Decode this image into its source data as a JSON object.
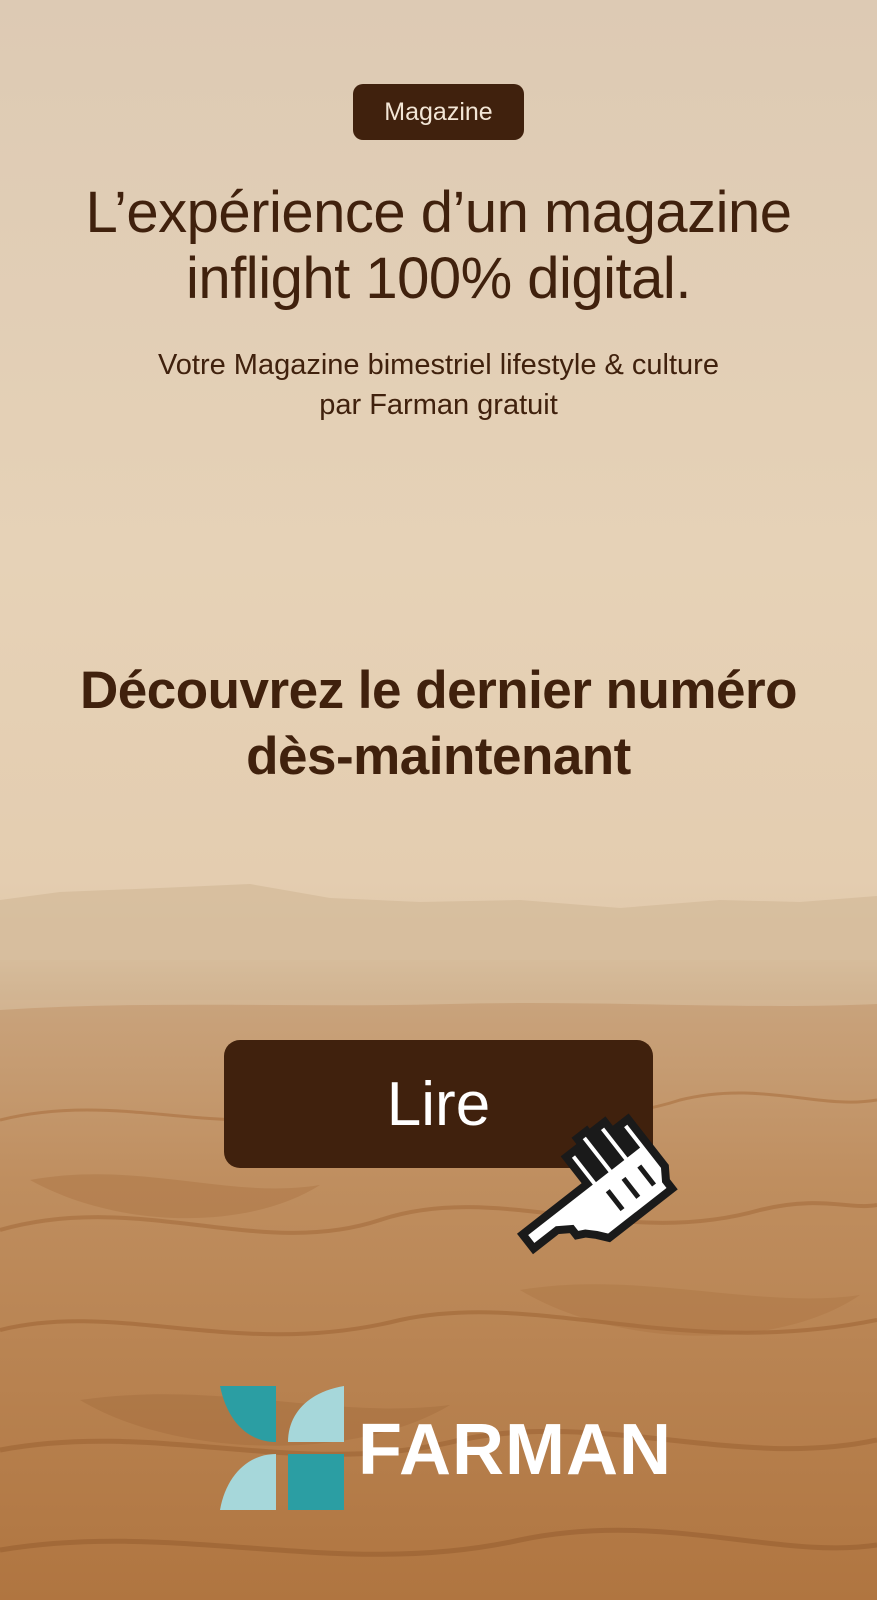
{
  "badge": {
    "label": "Magazine"
  },
  "hero": {
    "headline_line1": "L’expérience d’un magazine",
    "headline_line2": "inflight 100% digital.",
    "subtitle_line1": "Votre Magazine bimestriel lifestyle & culture",
    "subtitle_line2": "par Farman gratuit"
  },
  "cta": {
    "heading_line1": "Découvrez le dernier numéro",
    "heading_line2": "dès-maintenant",
    "button_label": "Lire"
  },
  "brand": {
    "name": "FARMAN",
    "logo": "four-petal-logo-icon"
  },
  "icons": {
    "cursor": "pointing-hand-cursor-icon"
  },
  "colors": {
    "primary_dark": "#40210d",
    "sky": "#e2cdb2",
    "sand": "#b97f4d",
    "logo_teal": "#2b9ea3",
    "logo_light_teal": "#a6d7da"
  }
}
